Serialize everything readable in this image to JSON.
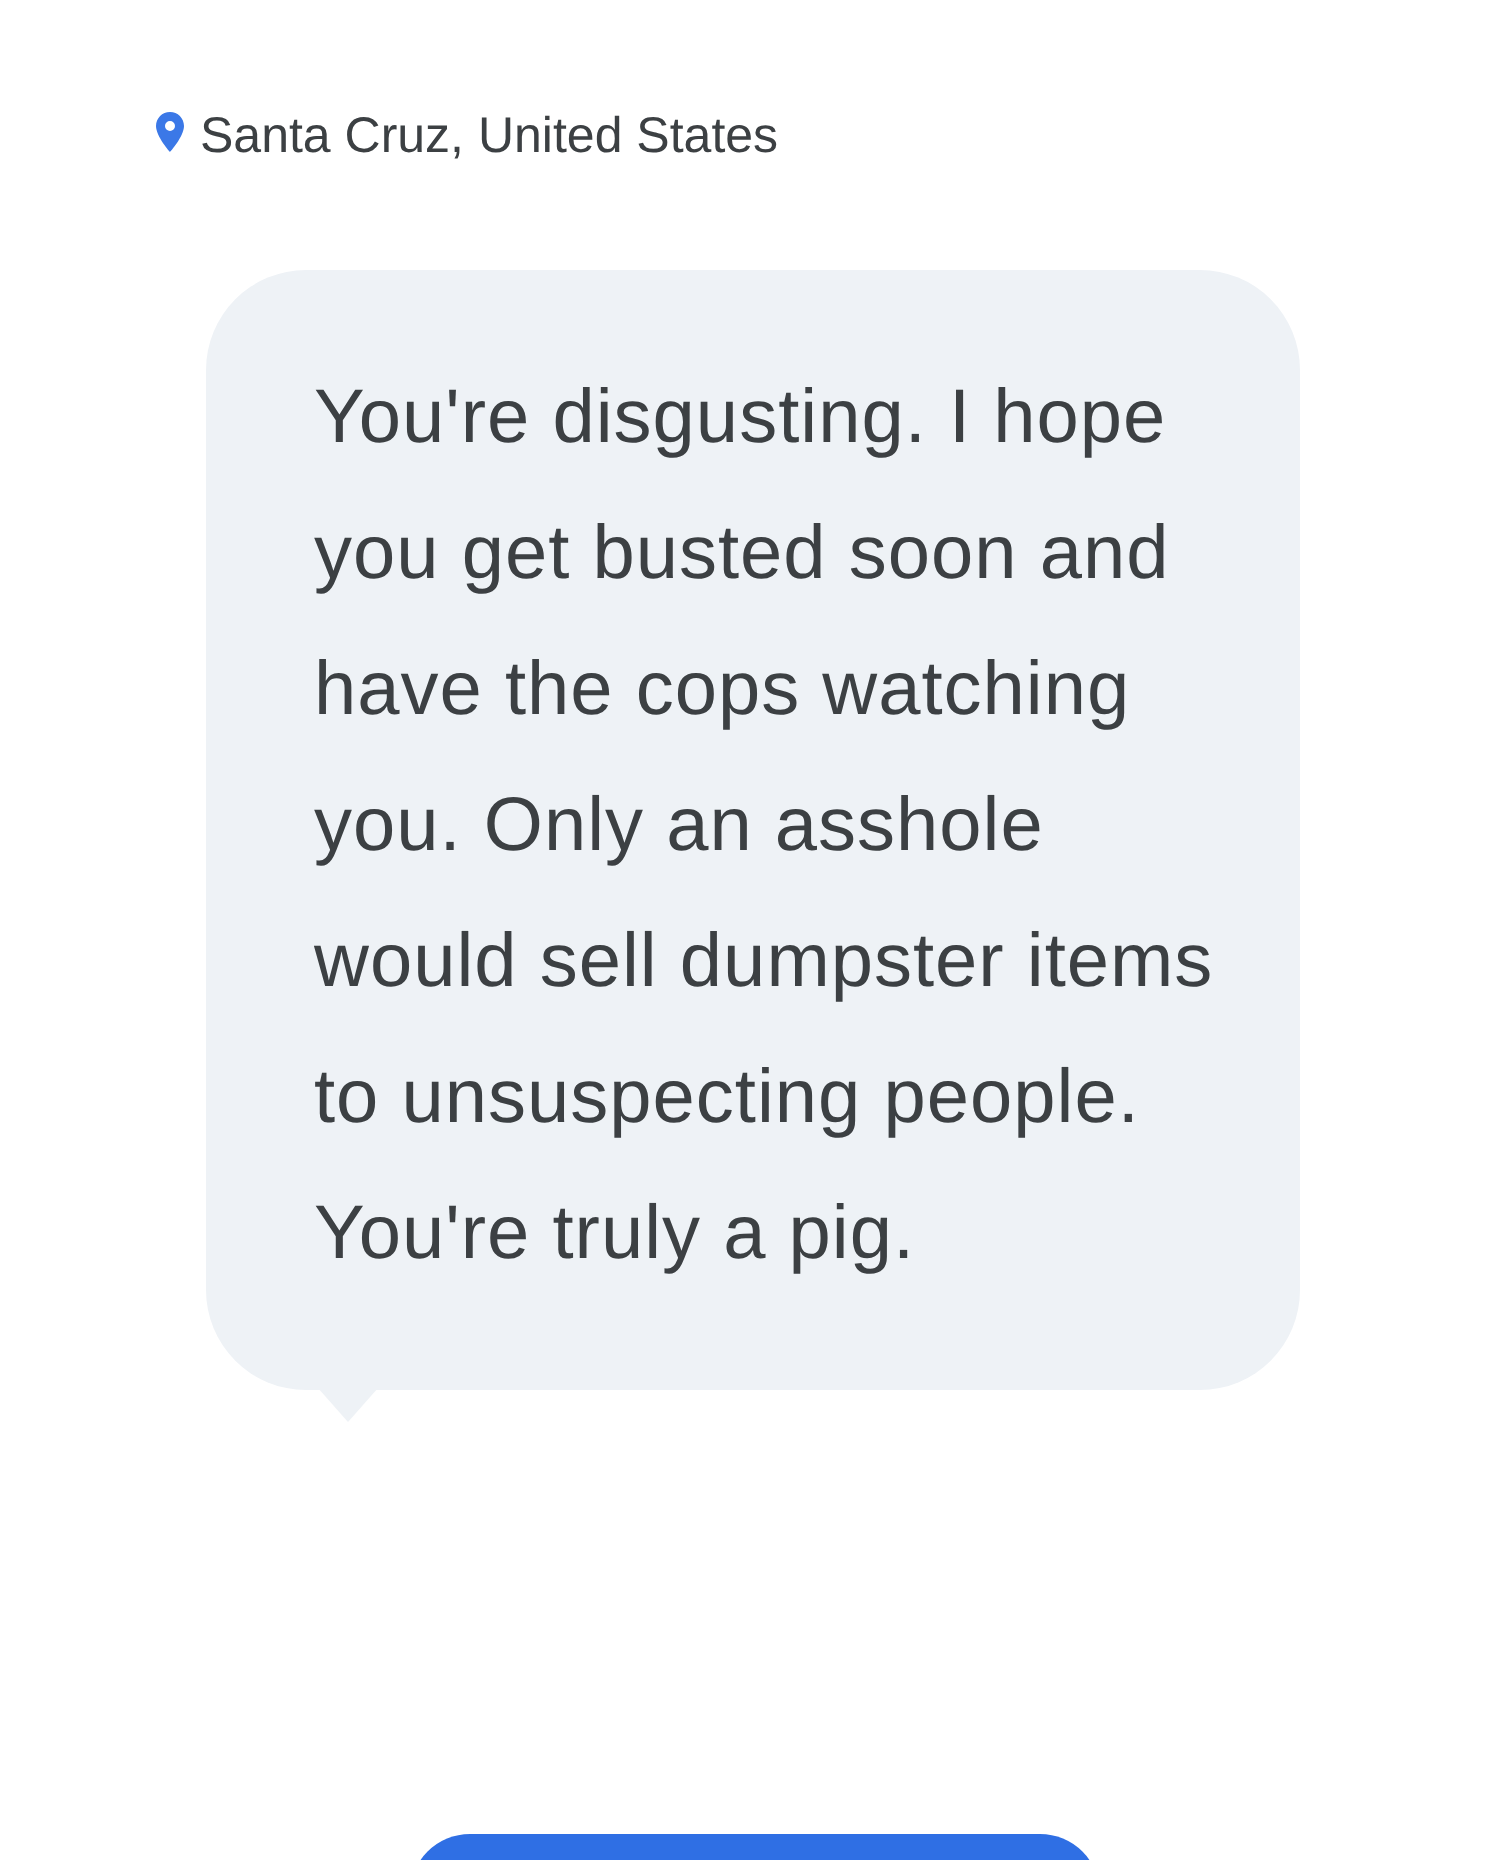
{
  "location": {
    "text": "Santa Cruz, United States"
  },
  "message": {
    "text": "You're disgusting. I hope you get busted soon and have the cops watching you. Only an asshole would sell dumpster items to unsuspecting people. You're truly a pig."
  }
}
